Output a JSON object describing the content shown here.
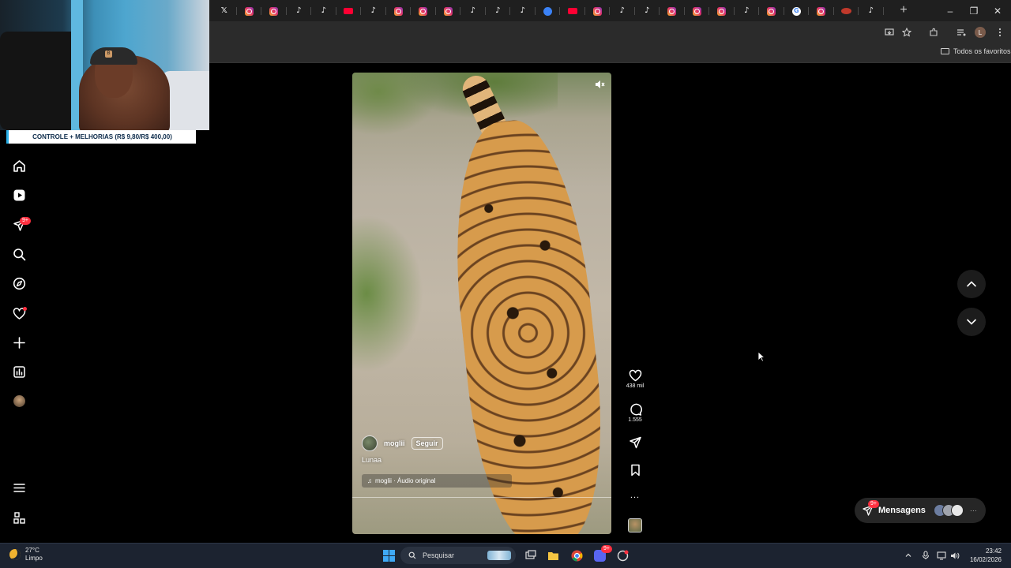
{
  "window": {
    "tabs": [
      "x",
      "ig",
      "ig",
      "tt",
      "tt",
      "yt",
      "tt",
      "ig",
      "ig",
      "ig",
      "tt",
      "tt",
      "tt",
      "blue",
      "yt",
      "ig",
      "tt",
      "tt",
      "ig",
      "ig",
      "ig",
      "tt",
      "ig",
      "g",
      "ig",
      "red",
      "tt"
    ],
    "new_tab": "+",
    "controls": {
      "minimize": "–",
      "restore": "❐",
      "close": "✕"
    }
  },
  "bookmarks": {
    "all_favorites": "Todos os favoritos"
  },
  "profile_initial": "L",
  "stream_overlay": {
    "banner": "CONTROLE + MELHORIAS (R$ 9,80/R$ 400,00)"
  },
  "sidebar": {
    "items": [
      {
        "name": "home-icon"
      },
      {
        "name": "reels-icon"
      },
      {
        "name": "messages-icon",
        "badge": "9+"
      },
      {
        "name": "search-icon"
      },
      {
        "name": "explore-icon"
      },
      {
        "name": "notifications-icon"
      },
      {
        "name": "create-icon"
      },
      {
        "name": "dashboard-icon"
      },
      {
        "name": "profile-avatar"
      }
    ],
    "more": "menu-icon",
    "also_from_meta": "apps-icon"
  },
  "reel": {
    "username": "moglii",
    "follow_label": "Seguir",
    "caption": "Lunaa",
    "audio": "moglii · Áudio original",
    "likes": "438 mil",
    "comments": "1.555",
    "more": "..."
  },
  "messages": {
    "label": "Mensagens",
    "badge": "9+",
    "more": "···"
  },
  "taskbar": {
    "temperature": "27°C",
    "condition": "Limpo",
    "search_placeholder": "Pesquisar",
    "chrome_badge": "9+",
    "time": "23:42",
    "date": "16/02/2026"
  },
  "colors": {
    "accent_red": "#ff3040",
    "instagram_bg": "#000000",
    "taskbar": "#1c2330"
  }
}
